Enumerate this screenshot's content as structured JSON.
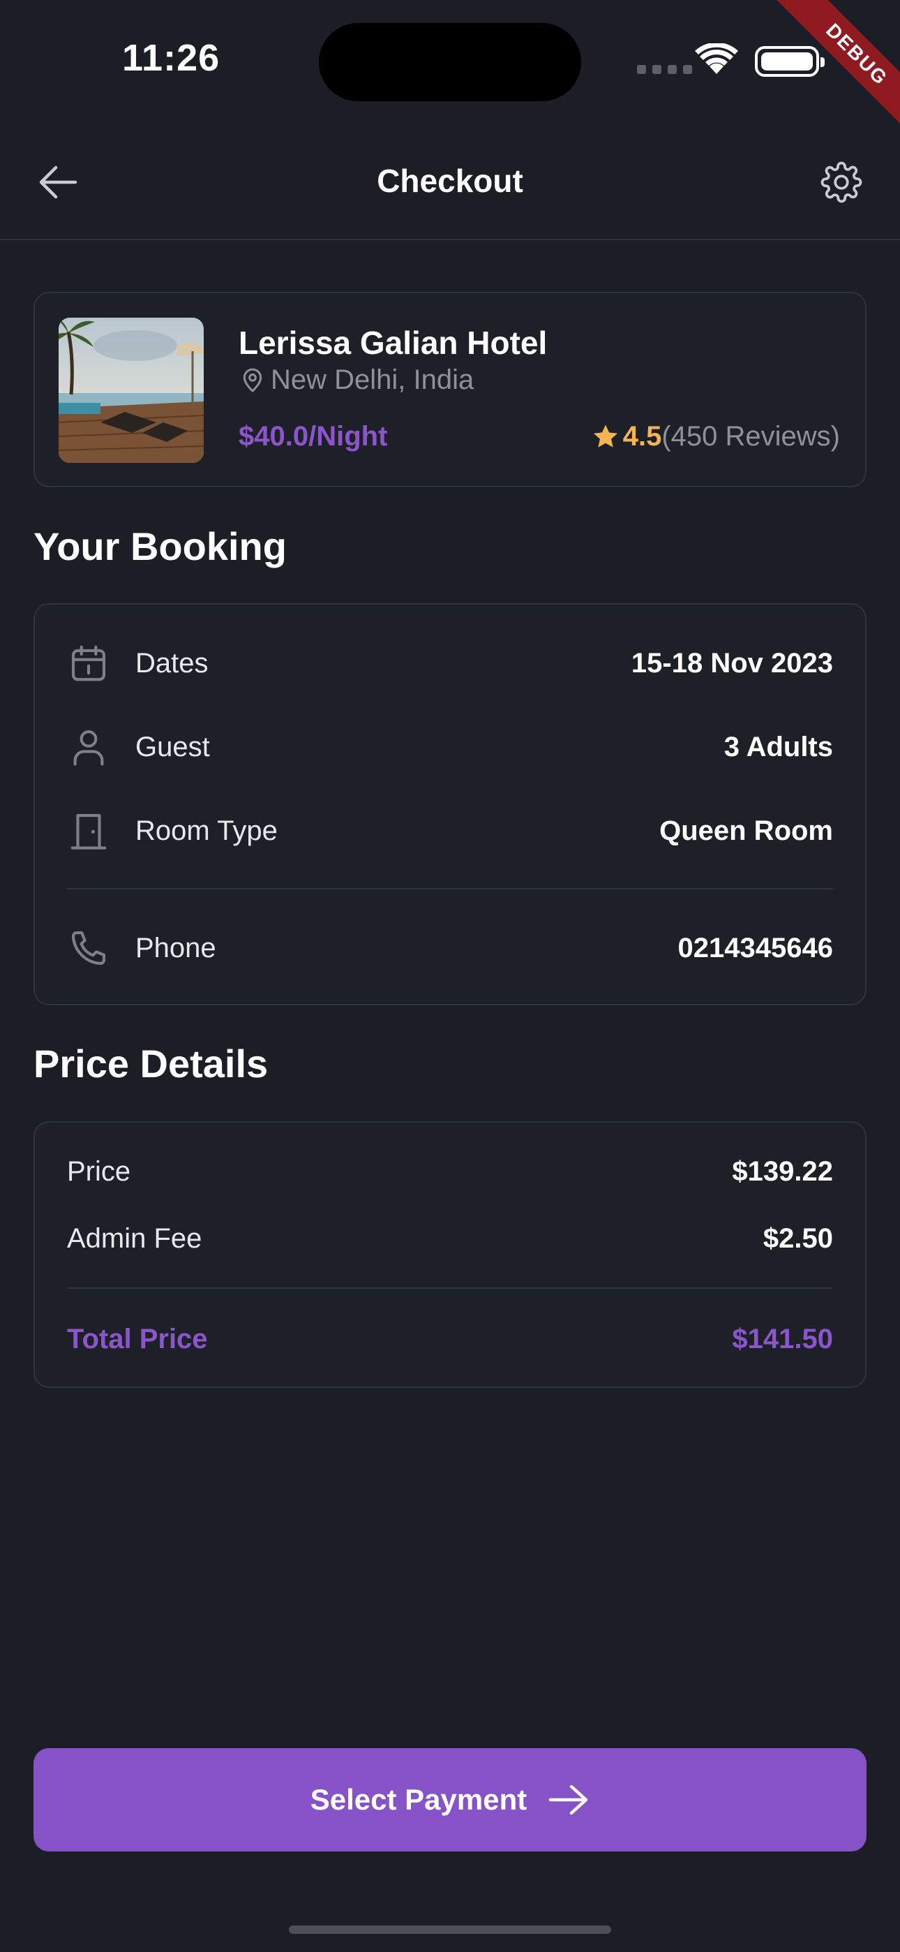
{
  "status_bar": {
    "time": "11:26"
  },
  "debug_banner": "DEBUG",
  "header": {
    "title": "Checkout",
    "back_icon": "arrow-left-icon",
    "settings_icon": "gear-icon"
  },
  "hotel": {
    "name": "Lerissa Galian Hotel",
    "location": "New Delhi, India",
    "price": "$40.0/Night",
    "rating": "4.5",
    "reviews": "(450 Reviews)"
  },
  "booking": {
    "heading": "Your Booking",
    "rows": [
      {
        "icon": "calendar-icon",
        "label": "Dates",
        "value": "15-18 Nov 2023"
      },
      {
        "icon": "person-icon",
        "label": "Guest",
        "value": "3 Adults"
      },
      {
        "icon": "door-icon",
        "label": "Room Type",
        "value": "Queen Room"
      },
      {
        "icon": "phone-icon",
        "label": "Phone",
        "value": "0214345646"
      }
    ]
  },
  "price_details": {
    "heading": "Price Details",
    "rows": [
      {
        "label": "Price",
        "value": "$139.22"
      },
      {
        "label": "Admin Fee",
        "value": "$2.50"
      }
    ],
    "total": {
      "label": "Total Price",
      "value": "$141.50"
    }
  },
  "cta": {
    "label": "Select Payment"
  },
  "colors": {
    "accent": "#8552c8",
    "background": "#1b1e24",
    "star": "#f4b452"
  }
}
